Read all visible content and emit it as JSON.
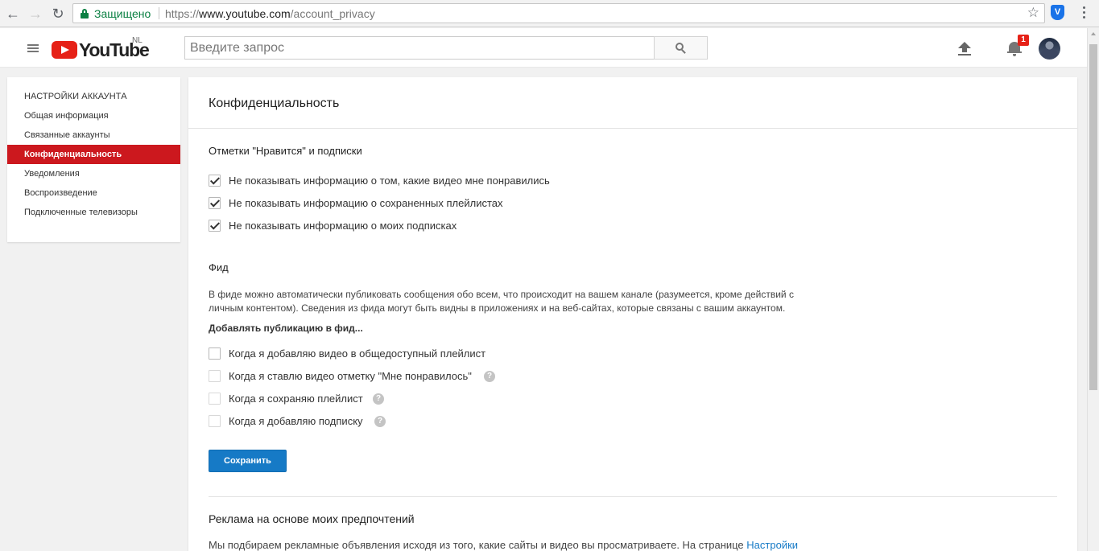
{
  "browser": {
    "secure_label": "Защищено",
    "url_scheme": "https://",
    "url_host": "www.youtube.com",
    "url_path": "/account_privacy"
  },
  "header": {
    "logo_text": "YouTube",
    "country_code": "NL",
    "search_placeholder": "Введите запрос",
    "notification_count": "1"
  },
  "sidebar": {
    "heading": "НАСТРОЙКИ АККАУНТА",
    "items": [
      {
        "label": "Общая информация"
      },
      {
        "label": "Связанные аккаунты"
      },
      {
        "label": "Конфиденциальность"
      },
      {
        "label": "Уведомления"
      },
      {
        "label": "Воспроизведение"
      },
      {
        "label": "Подключенные телевизоры"
      }
    ],
    "active_index": 2
  },
  "main": {
    "title": "Конфиденциальность",
    "likes_section": {
      "title": "Отметки \"Нравится\" и подписки",
      "options": [
        {
          "label": "Не показывать информацию о том, какие видео мне понравились",
          "checked": true
        },
        {
          "label": "Не показывать информацию о сохраненных плейлистах",
          "checked": true
        },
        {
          "label": "Не показывать информацию о моих подписках",
          "checked": true
        }
      ]
    },
    "feed_section": {
      "title": "Фид",
      "description_line1": "В фиде можно автоматически публиковать сообщения обо всем, что происходит на вашем канале (разумеется, кроме действий с",
      "description_line2": "личным контентом). Сведения из фида могут быть видны в приложениях и на веб-сайтах, которые связаны с вашим аккаунтом.",
      "subheading": "Добавлять публикацию в фид...",
      "options": [
        {
          "label": "Когда я добавляю видео в общедоступный плейлист",
          "checked": false,
          "help": false
        },
        {
          "label": "Когда я ставлю видео отметку \"Мне понравилось\"",
          "checked": false,
          "help": true
        },
        {
          "label": "Когда я сохраняю плейлист",
          "checked": false,
          "help": true
        },
        {
          "label": "Когда я добавляю подписку",
          "checked": false,
          "help": true
        }
      ]
    },
    "save_label": "Сохранить",
    "ads_section": {
      "title": "Реклама на основе моих предпочтений",
      "text": "Мы подбираем рекламные объявления исходя из того, какие сайты и видео вы просматриваете. На странице ",
      "link": "Настройки"
    }
  },
  "colors": {
    "accent_red": "#cc181e",
    "button_blue": "#167ac6",
    "secure_green": "#0b8043"
  }
}
